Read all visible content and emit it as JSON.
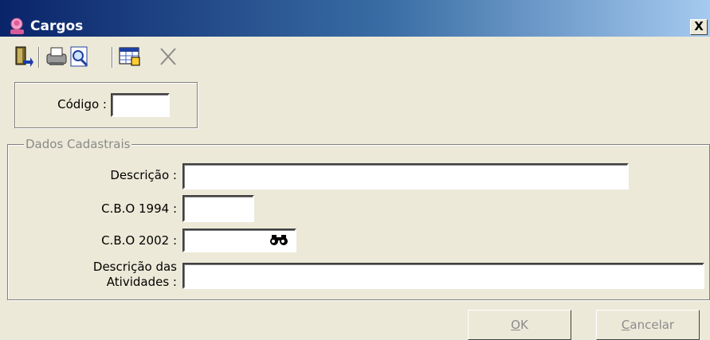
{
  "window": {
    "title": "Cargos",
    "close_glyph": "X"
  },
  "toolbar": {
    "buttons": [
      {
        "name": "exit-icon"
      },
      {
        "name": "print-icon"
      },
      {
        "name": "preview-icon"
      },
      {
        "name": "grid-icon"
      },
      {
        "name": "delete-icon"
      }
    ]
  },
  "codigo": {
    "label": "Código :",
    "value": ""
  },
  "dados": {
    "legend": "Dados Cadastrais",
    "descricao_label": "Descrição :",
    "descricao_value": "",
    "cbo1994_label": "C.B.O 1994 :",
    "cbo1994_value": "",
    "cbo2002_label": "C.B.O 2002 :",
    "cbo2002_value": "",
    "atividades_label_line1": "Descrição das",
    "atividades_label_line2": "Atividades :",
    "atividades_value": ""
  },
  "buttons": {
    "ok_mnemonic": "O",
    "ok_rest": "K",
    "cancel_mnemonic": "C",
    "cancel_rest": "ancelar"
  },
  "colors": {
    "title_bar_start": "#0a246a",
    "title_bar_end": "#a6caf0",
    "face": "#ece9d8",
    "disabled_text": "#8c8c8c"
  }
}
